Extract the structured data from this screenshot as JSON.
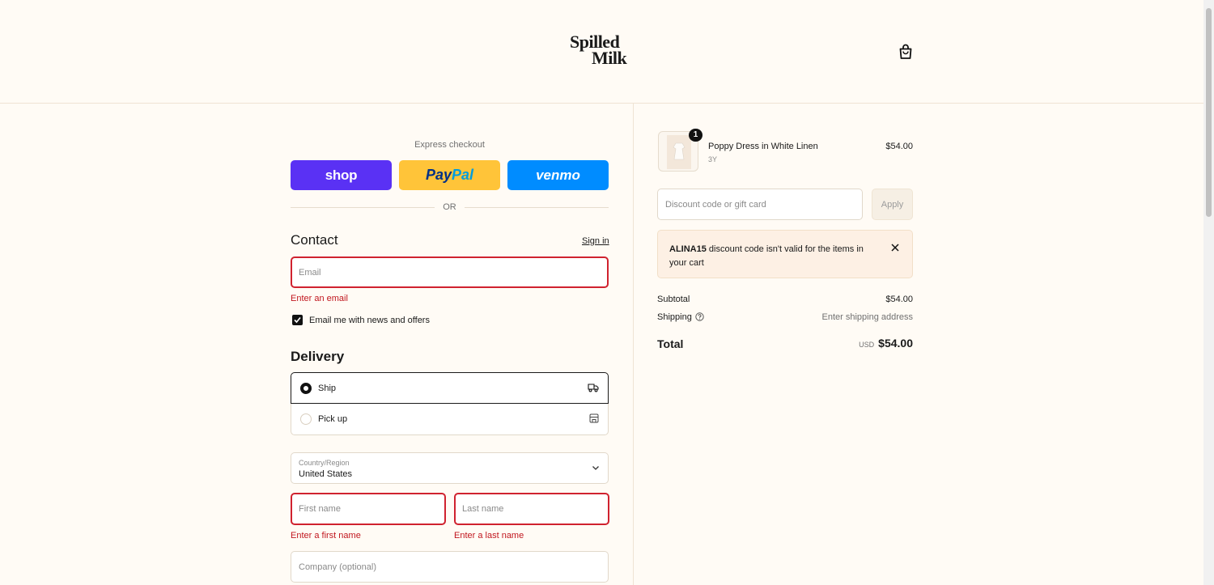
{
  "header": {
    "logo_line1": "Spilled",
    "logo_line2": "Milk"
  },
  "express": {
    "label": "Express checkout",
    "shop": "shop",
    "paypal_a": "Pay",
    "paypal_b": "Pal",
    "venmo": "venmo",
    "or": "OR"
  },
  "contact": {
    "heading": "Contact",
    "sign_in": "Sign in",
    "email_placeholder": "Email",
    "email_error": "Enter an email",
    "newsletter_label": "Email me with news and offers",
    "newsletter_checked": true
  },
  "delivery": {
    "heading": "Delivery",
    "options": [
      {
        "label": "Ship",
        "selected": true,
        "icon": "truck-icon"
      },
      {
        "label": "Pick up",
        "selected": false,
        "icon": "store-icon"
      }
    ],
    "country_label": "Country/Region",
    "country_value": "United States",
    "first_name_placeholder": "First name",
    "first_name_error": "Enter a first name",
    "last_name_placeholder": "Last name",
    "last_name_error": "Enter a last name",
    "company_placeholder": "Company (optional)"
  },
  "summary": {
    "item": {
      "quantity": "1",
      "name": "Poppy Dress in White Linen",
      "variant": "3Y",
      "price": "$54.00"
    },
    "discount_placeholder": "Discount code or gift card",
    "apply_label": "Apply",
    "notice_code": "ALINA15",
    "notice_text": " discount code isn't valid for the items in your cart",
    "subtotal_label": "Subtotal",
    "subtotal_value": "$54.00",
    "shipping_label": "Shipping",
    "shipping_value": "Enter shipping address",
    "total_label": "Total",
    "total_currency": "USD",
    "total_value": "$54.00"
  },
  "colors": {
    "background": "#fffbf5",
    "error": "#d0222f",
    "shop": "#5a31f4",
    "paypal": "#ffc439",
    "venmo": "#008cff"
  }
}
